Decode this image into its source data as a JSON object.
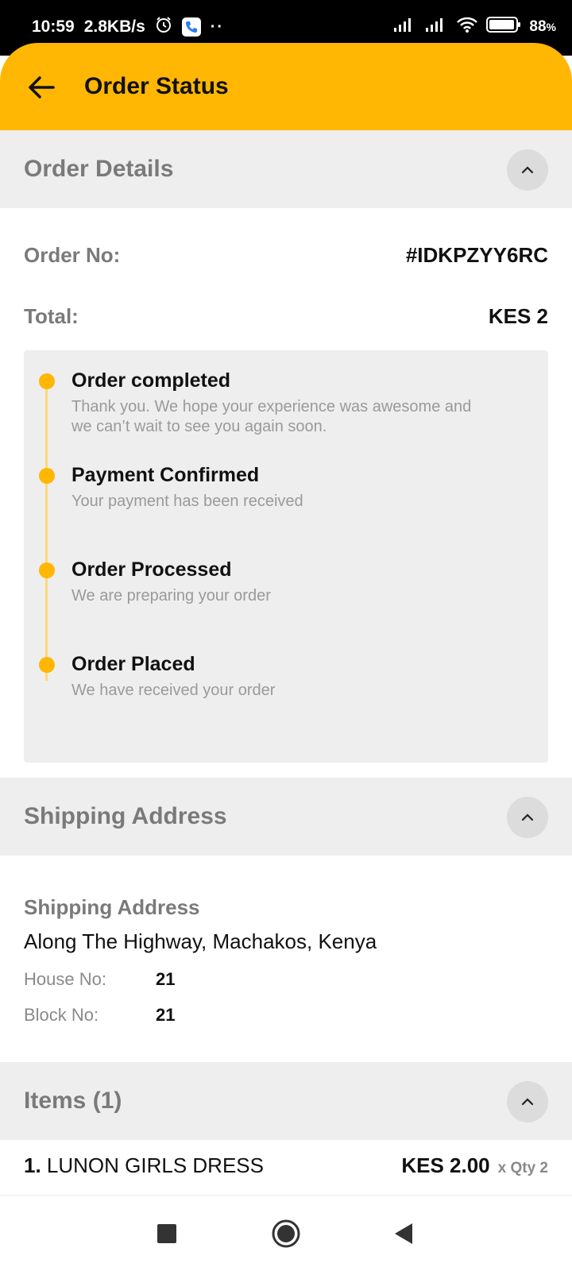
{
  "status_bar": {
    "time": "10:59",
    "speed": "2.8KB/s",
    "battery": "88",
    "battery_unit": "%"
  },
  "app_bar": {
    "title": "Order Status"
  },
  "order_details": {
    "header": "Order Details",
    "order_no_label": "Order No:",
    "order_no_value": "#IDKPZYY6RC",
    "total_label": "Total:",
    "total_value": "KES 2",
    "timeline": [
      {
        "title": "Order completed",
        "desc": "Thank you. We hope your experience was awesome and we can’t wait to see you again soon."
      },
      {
        "title": "Payment Confirmed",
        "desc": "Your payment has been received"
      },
      {
        "title": "Order Processed",
        "desc": "We are preparing your order"
      },
      {
        "title": "Order Placed",
        "desc": "We have received your order"
      }
    ]
  },
  "shipping": {
    "header": "Shipping Address",
    "label": "Shipping Address",
    "address": "Along The Highway, Machakos, Kenya",
    "house_label": "House No:",
    "house_value": "21",
    "block_label": "Block No:",
    "block_value": "21"
  },
  "items": {
    "header": "Items (1)",
    "list": [
      {
        "number": "1.",
        "name": "LUNON GIRLS DRESS",
        "price": "KES 2.00",
        "qty": "x Qty 2"
      }
    ]
  },
  "colors": {
    "accent": "#FFB703",
    "timeline_line": "#FCD97A",
    "section_bg": "#EEEEEE"
  },
  "icons": {
    "back": "arrow-left-icon",
    "collapse": "chevron-up-icon",
    "nav_recents": "square-icon",
    "nav_home": "circle-icon",
    "nav_back": "triangle-left-icon"
  }
}
